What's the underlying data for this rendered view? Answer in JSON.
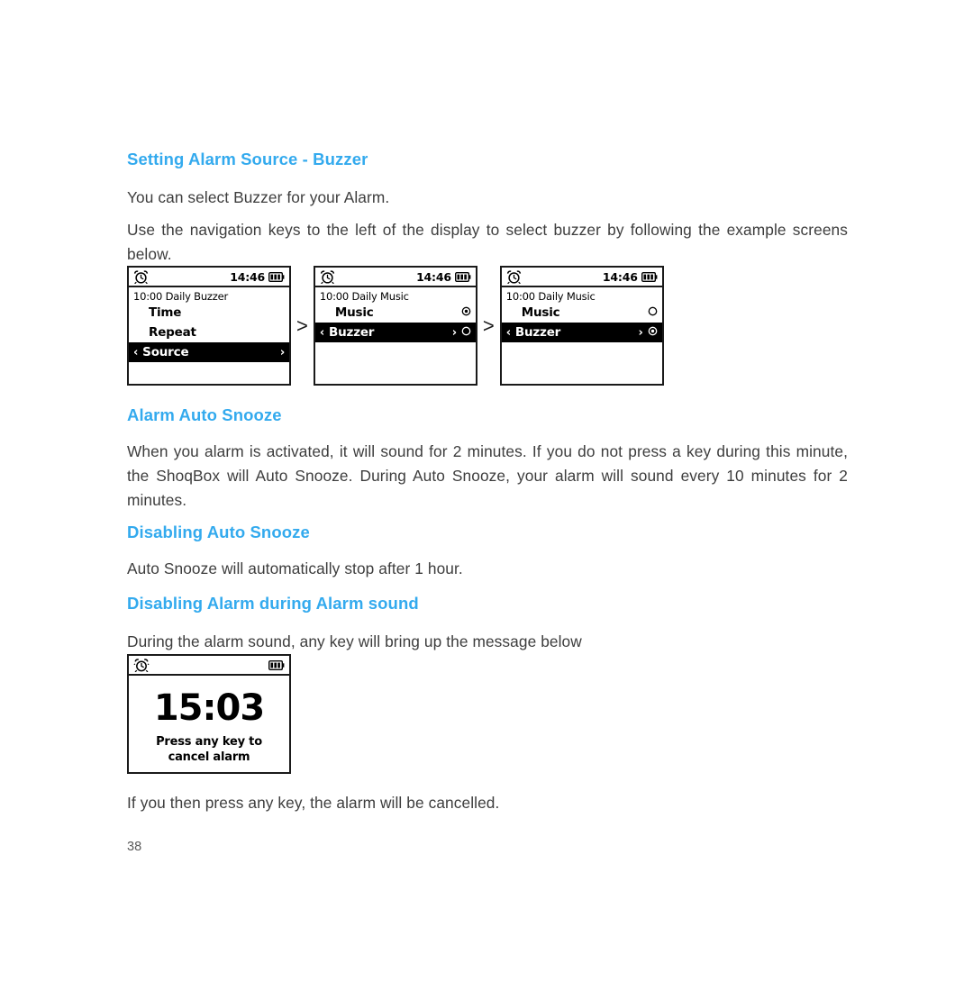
{
  "document": {
    "page_number": "38",
    "heading_color": "#33aaee",
    "body_color": "#3d3d3d"
  },
  "sections": {
    "setting_alarm_source": {
      "heading": "Setting Alarm Source - Buzzer",
      "para1": "You can select Buzzer for your Alarm.",
      "para2": "Use the navigation keys to the left of the display to select buzzer by following the example screens below."
    },
    "alarm_auto_snooze": {
      "heading": "Alarm Auto Snooze",
      "para1": "When you alarm is activated, it will sound for 2 minutes. If you do not press a key during this minute, the ShoqBox will Auto Snooze. During  Auto Snooze, your alarm will sound every 10 minutes for 2 minutes."
    },
    "disabling_auto_snooze": {
      "heading": "Disabling Auto Snooze",
      "para1": "Auto Snooze will automatically stop after 1 hour."
    },
    "disabling_alarm_during_sound": {
      "heading": "Disabling Alarm during Alarm sound",
      "para1": "During the alarm sound, any key will bring up the message below",
      "para2": "If you then press any key, the alarm will be cancelled."
    }
  },
  "screens": {
    "separator": ">",
    "screen1": {
      "status": {
        "alarm_icon": "alarm-clock-icon",
        "clock": "14:46",
        "battery_icon": "battery-full-icon"
      },
      "info_line": "10:00 Daily Buzzer",
      "rows": [
        {
          "label": "Time",
          "selected": false,
          "left_caret": "",
          "right_caret": "",
          "radio": ""
        },
        {
          "label": "Repeat",
          "selected": false,
          "left_caret": "",
          "right_caret": "",
          "radio": ""
        },
        {
          "label": "Source",
          "selected": true,
          "left_caret": "‹",
          "right_caret": "›",
          "radio": ""
        }
      ]
    },
    "screen2": {
      "status": {
        "alarm_icon": "alarm-clock-icon",
        "clock": "14:46",
        "battery_icon": "battery-full-icon"
      },
      "info_line": "10:00 Daily Music",
      "rows": [
        {
          "label": "Music",
          "selected": false,
          "left_caret": "",
          "right_caret": "",
          "radio": "selected"
        },
        {
          "label": "Buzzer",
          "selected": true,
          "left_caret": "‹",
          "right_caret": "›",
          "radio": "empty"
        }
      ]
    },
    "screen3": {
      "status": {
        "alarm_icon": "alarm-clock-icon",
        "clock": "14:46",
        "battery_icon": "battery-full-icon"
      },
      "info_line": "10:00 Daily Music",
      "rows": [
        {
          "label": "Music",
          "selected": false,
          "left_caret": "",
          "right_caret": "",
          "radio": "empty"
        },
        {
          "label": "Buzzer",
          "selected": true,
          "left_caret": "‹",
          "right_caret": "›",
          "radio": "selected"
        }
      ]
    },
    "alarm_screen": {
      "status": {
        "alarm_icon": "alarm-clock-icon",
        "battery_icon": "battery-full-icon"
      },
      "time": "15:03",
      "message_line1": "Press any key to",
      "message_line2": "cancel alarm"
    }
  }
}
